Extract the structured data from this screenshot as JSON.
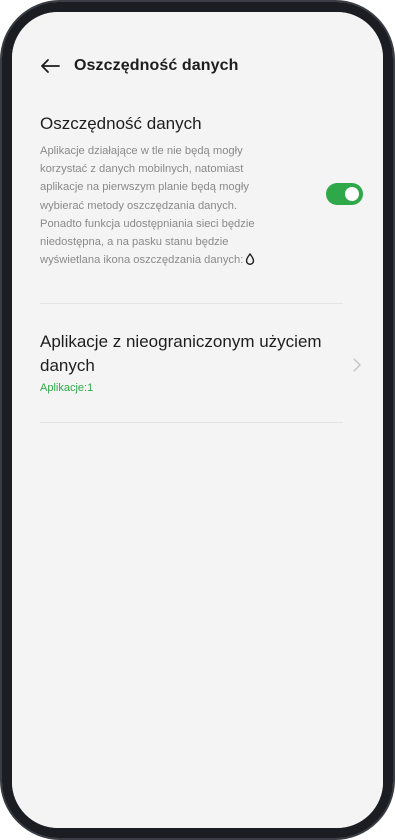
{
  "header": {
    "title": "Oszczędność danych"
  },
  "data_saver": {
    "title": "Oszczędność danych",
    "description": "Aplikacje działające w tle nie będą mogły korzystać z danych mobilnych, natomiast aplikacje na pierwszym planie będą mogły wybierać metody oszczędzania danych. Ponadto funkcja udostępniania sieci będzie niedostępna, a na pasku stanu będzie wyświetlana ikona oszczędzania danych:",
    "enabled": true,
    "toggle_color": "#2fa84a"
  },
  "unrestricted": {
    "title": "Aplikacje z nieograniczonym użyciem danych",
    "subtitle": "Aplikacje:1",
    "subtitle_color": "#2fa84a"
  },
  "icons": {
    "back": "arrow-left-icon",
    "data_saver": "droplet-icon",
    "chevron": "chevron-right-icon"
  }
}
